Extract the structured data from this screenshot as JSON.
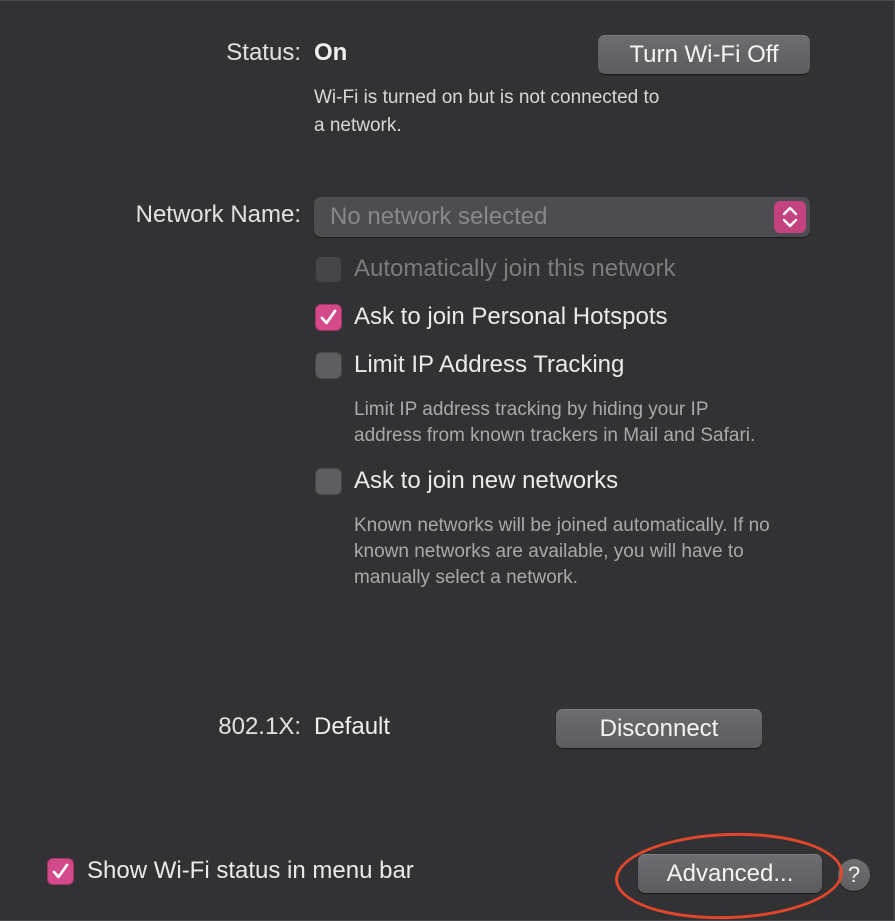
{
  "status": {
    "label": "Status:",
    "value": "On",
    "description_line1": "Wi-Fi is turned on but is not connected to",
    "description_line2": "a network.",
    "toggle_button": "Turn Wi-Fi Off"
  },
  "network": {
    "label": "Network Name:",
    "placeholder": "No network selected"
  },
  "options": {
    "auto_join": {
      "label": "Automatically join this network",
      "checked": false,
      "disabled": true
    },
    "personal_hotspots": {
      "label": "Ask to join Personal Hotspots",
      "checked": true
    },
    "limit_ip": {
      "label": "Limit IP Address Tracking",
      "checked": false,
      "help_line1": "Limit IP address tracking by hiding your IP",
      "help_line2": "address from known trackers in Mail and Safari."
    },
    "new_networks": {
      "label": "Ask to join new networks",
      "checked": false,
      "help_line1": "Known networks will be joined automatically. If no",
      "help_line2": "known networks are available, you will have to",
      "help_line3": "manually select a network."
    }
  },
  "dot1x": {
    "label": "802.1X:",
    "value": "Default",
    "disconnect_button": "Disconnect"
  },
  "footer": {
    "menu_bar_label": "Show Wi-Fi status in menu bar",
    "menu_bar_checked": true,
    "advanced_button": "Advanced...",
    "help_symbol": "?"
  },
  "colors": {
    "accent": "#d4498a",
    "annotation": "#e2462c",
    "background": "#323234"
  },
  "icons": {
    "stepper": "chevron-up-down-icon",
    "check": "checkmark-icon",
    "help": "question-mark-icon"
  }
}
